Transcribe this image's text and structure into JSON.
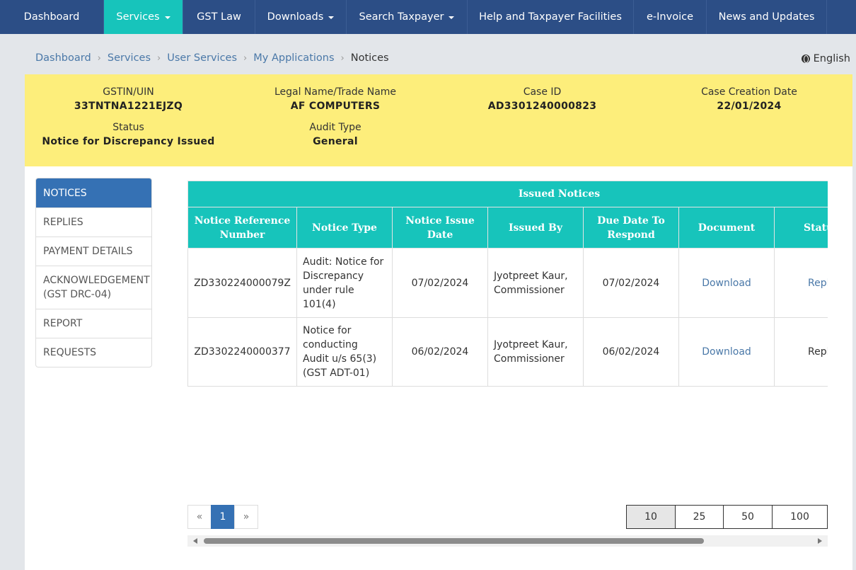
{
  "nav": {
    "items": [
      {
        "label": "Dashboard"
      },
      {
        "label": "Services"
      },
      {
        "label": "GST Law"
      },
      {
        "label": "Downloads"
      },
      {
        "label": "Search Taxpayer"
      },
      {
        "label": "Help and Taxpayer Facilities"
      },
      {
        "label": "e-Invoice"
      },
      {
        "label": "News and Updates"
      }
    ]
  },
  "breadcrumb": [
    "Dashboard",
    "Services",
    "User Services",
    "My Applications",
    "Notices"
  ],
  "language": "English",
  "case_info": {
    "gstin_label": "GSTIN/UIN",
    "gstin": "33TNTNA1221EJZQ",
    "name_label": "Legal Name/Trade Name",
    "name": "AF COMPUTERS",
    "caseid_label": "Case ID",
    "caseid": "AD3301240000823",
    "date_label": "Case Creation Date",
    "date": "22/01/2024",
    "status_label": "Status",
    "status": "Notice for Discrepancy Issued",
    "audit_label": "Audit Type",
    "audit": "General"
  },
  "sidemenu": [
    "NOTICES",
    "REPLIES",
    "PAYMENT DETAILS",
    "ACKNOWLEDGEMENT (GST DRC-04)",
    "REPORT",
    "REQUESTS"
  ],
  "table": {
    "caption": "Issued Notices",
    "headers": [
      "Notice Reference Number",
      "Notice Type",
      "Notice Issue Date",
      "Issued By",
      "Due Date To Respond",
      "Document",
      "Status"
    ],
    "rows": [
      {
        "ref": "ZD330224000079Z",
        "type": "Audit: Notice for Discrepancy under rule 101(4)",
        "issue_date": "07/02/2024",
        "issued_by": "Jyotpreet Kaur, Commissioner",
        "due_date": "07/02/2024",
        "document": "Download",
        "status": "Reply"
      },
      {
        "ref": "ZD3302240000377",
        "type": "Notice for conducting Audit u/s 65(3) (GST ADT-01)",
        "issue_date": "06/02/2024",
        "issued_by": "Jyotpreet Kaur, Commissioner",
        "due_date": "06/02/2024",
        "document": "Download",
        "status": "Replied"
      }
    ]
  },
  "pagination": {
    "prev": "«",
    "current": "1",
    "next": "»"
  },
  "page_sizes": [
    "10",
    "25",
    "50",
    "100"
  ]
}
